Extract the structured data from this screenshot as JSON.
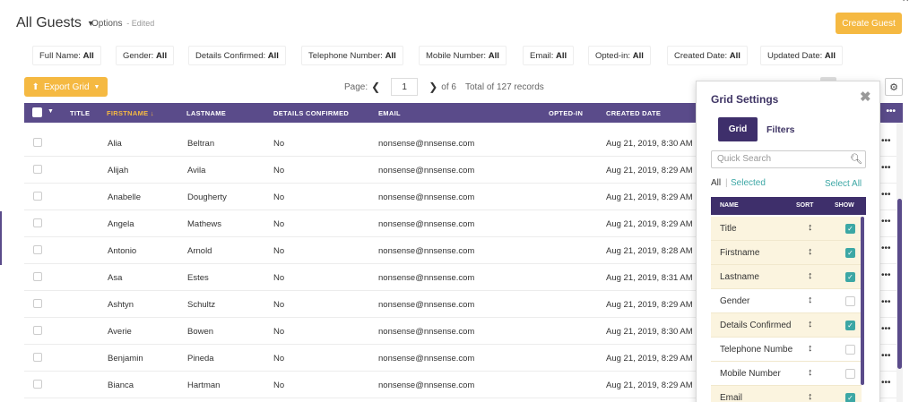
{
  "header": {
    "title": "All Guests",
    "options_label": "Options",
    "edited_label": "- Edited",
    "create_button": "Create Guest"
  },
  "filters": [
    {
      "label": "Full Name:",
      "value": "All"
    },
    {
      "label": "Gender:",
      "value": "All"
    },
    {
      "label": "Details Confirmed:",
      "value": "All"
    },
    {
      "label": "Telephone Number:",
      "value": "All"
    },
    {
      "label": "Mobile Number:",
      "value": "All"
    },
    {
      "label": "Email:",
      "value": "All"
    },
    {
      "label": "Opted-in:",
      "value": "All"
    },
    {
      "label": "Created Date:",
      "value": "All"
    },
    {
      "label": "Updated Date:",
      "value": "All"
    }
  ],
  "toolbar": {
    "export_label": "Export Grid",
    "page_label": "Page:",
    "page_value": "1",
    "page_of": "of 6",
    "total_label": "Total of 127 records"
  },
  "columns": {
    "title": "TITLE",
    "firstname": "FIRSTNAME",
    "lastname": "LASTNAME",
    "details": "DETAILS CONFIRMED",
    "email": "EMAIL",
    "opted": "OPTED-IN",
    "created": "CREATED DATE"
  },
  "rows": [
    {
      "first": "Alia",
      "last": "Beltran",
      "details": "No",
      "email": "nonsense@nnsense.com",
      "created": "Aug 21, 2019, 8:30 AM"
    },
    {
      "first": "Alijah",
      "last": "Avila",
      "details": "No",
      "email": "nonsense@nnsense.com",
      "created": "Aug 21, 2019, 8:29 AM"
    },
    {
      "first": "Anabelle",
      "last": "Dougherty",
      "details": "No",
      "email": "nonsense@nnsense.com",
      "created": "Aug 21, 2019, 8:29 AM"
    },
    {
      "first": "Angela",
      "last": "Mathews",
      "details": "No",
      "email": "nonsense@nnsense.com",
      "created": "Aug 21, 2019, 8:29 AM"
    },
    {
      "first": "Antonio",
      "last": "Arnold",
      "details": "No",
      "email": "nonsense@nnsense.com",
      "created": "Aug 21, 2019, 8:28 AM"
    },
    {
      "first": "Asa",
      "last": "Estes",
      "details": "No",
      "email": "nonsense@nnsense.com",
      "created": "Aug 21, 2019, 8:31 AM"
    },
    {
      "first": "Ashtyn",
      "last": "Schultz",
      "details": "No",
      "email": "nonsense@nnsense.com",
      "created": "Aug 21, 2019, 8:29 AM"
    },
    {
      "first": "Averie",
      "last": "Bowen",
      "details": "No",
      "email": "nonsense@nnsense.com",
      "created": "Aug 21, 2019, 8:30 AM"
    },
    {
      "first": "Benjamin",
      "last": "Pineda",
      "details": "No",
      "email": "nonsense@nnsense.com",
      "created": "Aug 21, 2019, 8:29 AM"
    },
    {
      "first": "Bianca",
      "last": "Hartman",
      "details": "No",
      "email": "nonsense@nnsense.com",
      "created": "Aug 21, 2019, 8:29 AM"
    }
  ],
  "panel": {
    "title": "Grid Settings",
    "tab_grid": "Grid",
    "tab_filters": "Filters",
    "search_placeholder": "Quick Search",
    "link_all": "All",
    "link_selected": "Selected",
    "select_all": "Select All",
    "head_name": "NAME",
    "head_sort": "SORT",
    "head_show": "SHOW",
    "items": [
      {
        "name": "Title",
        "show": true
      },
      {
        "name": "Firstname",
        "show": true
      },
      {
        "name": "Lastname",
        "show": true
      },
      {
        "name": "Gender",
        "show": false
      },
      {
        "name": "Details Confirmed",
        "show": true
      },
      {
        "name": "Telephone Numbe",
        "show": false
      },
      {
        "name": "Mobile Number",
        "show": false
      },
      {
        "name": "Email",
        "show": true
      }
    ]
  },
  "icons": {
    "sort_glyph": "↕",
    "check_glyph": "✓",
    "more_glyph": "•••"
  },
  "colors": {
    "accent": "#f5b942",
    "header_purple": "#5a4b8a",
    "panel_purple": "#3e2f6b",
    "teal": "#3ca7a5"
  }
}
